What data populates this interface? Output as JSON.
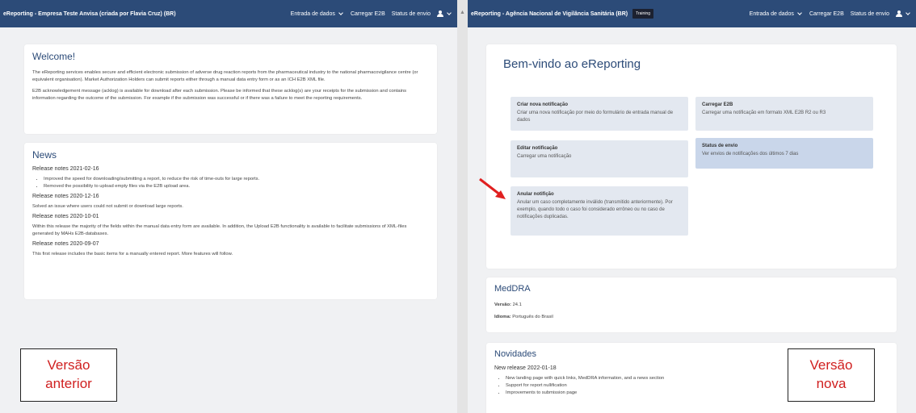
{
  "left": {
    "navbar": {
      "title": "eReporting - Empresa Teste Anvisa (criada por Flavia Cruz) (BR)",
      "items": [
        "Entrada de dados",
        "Carregar E2B",
        "Status de envio"
      ]
    },
    "welcome": {
      "heading": "Welcome!",
      "p1": "The eReporting services enables secure and efficient electronic submission of adverse drug reaction reports from the pharmaceutical industry to the national pharmacovigilance centre (or equivalent organisation). Market Authorization Holders can submit reports either through a manual data entry form or as an ICH E2B XML file.",
      "p2": "E2B acknowledgement message (acklog) is available for download after each submission. Please be informed that these acklog(s) are your receipts for the submission and contains information regarding the outcome of the submission. For example if the submission was successful or if there was a failure to meet the reporting requirements."
    },
    "news": {
      "heading": "News",
      "r1_title": "Release notes 2021-02-16",
      "r1_items": [
        "Improved the speed for downloading/submitting a report, to reduce the risk of time-outs for large reports.",
        "Removed the possibility to upload empty files via the E2B upload area."
      ],
      "r2_title": "Release notes 2020-12-16",
      "r2_text": "Solved an issue where users could not submit or download large reports.",
      "r3_title": "Release notes 2020-10-01",
      "r3_text": "Within this release the majority of the fields within the manual data entry form are available. In addition, the Upload E2B functionality is available to facilitate submissions of XML-files generated by MAHs E2B-databases.",
      "r4_title": "Release notes 2020-09-07",
      "r4_text": "This first release includes the basic items for a manually entered report. More features will follow."
    },
    "label": [
      "Versão",
      "anterior"
    ]
  },
  "right": {
    "navbar": {
      "title": "eReporting - Agência Nacional de Vigilância Sanitária (BR)",
      "badge": "Training",
      "items": [
        "Entrada de dados",
        "Carregar E2B",
        "Status de envio"
      ]
    },
    "bemvindo": {
      "heading": "Bem-vindo ao eReporting",
      "tiles": [
        {
          "title": "Criar nova notificação",
          "desc": "Criar uma nova notificação por meio do formulário de entrada manual de dados"
        },
        {
          "title": "Carregar E2B",
          "desc": "Carregar uma notificação em formato XML E2B R2 ou R3"
        },
        {
          "title": "Editar notificação",
          "desc": "Carregar uma notificação"
        },
        {
          "title": "Status de envio",
          "desc": "Ver envios de notificações dos últimos 7 dias"
        },
        {
          "title": "Anular notifição",
          "desc": "Anular um caso completamente inválido (transmitido anteriormente). Por exemplo, quando todo o caso foi considerado errôneo ou no caso de notificações duplicadas."
        }
      ]
    },
    "meddra": {
      "heading": "MedDRA",
      "version_label": "Versão:",
      "version": "24.1",
      "language_label": "Idioma:",
      "language": "Português do Brasil"
    },
    "novidades": {
      "heading": "Novidades",
      "release_title": "New release 2022-01-18",
      "items": [
        "New landing page with quick links, MedDRA information, and a news section",
        "Support for report nullification",
        "Improvements to submission page"
      ]
    },
    "label": [
      "Versão",
      "nova"
    ]
  },
  "colors": {
    "navbar": "#2c4b78",
    "tile": "#e3e8f0",
    "tile_highlight": "#c9d6ea",
    "label_text": "#d02020",
    "arrow": "#e02020"
  }
}
